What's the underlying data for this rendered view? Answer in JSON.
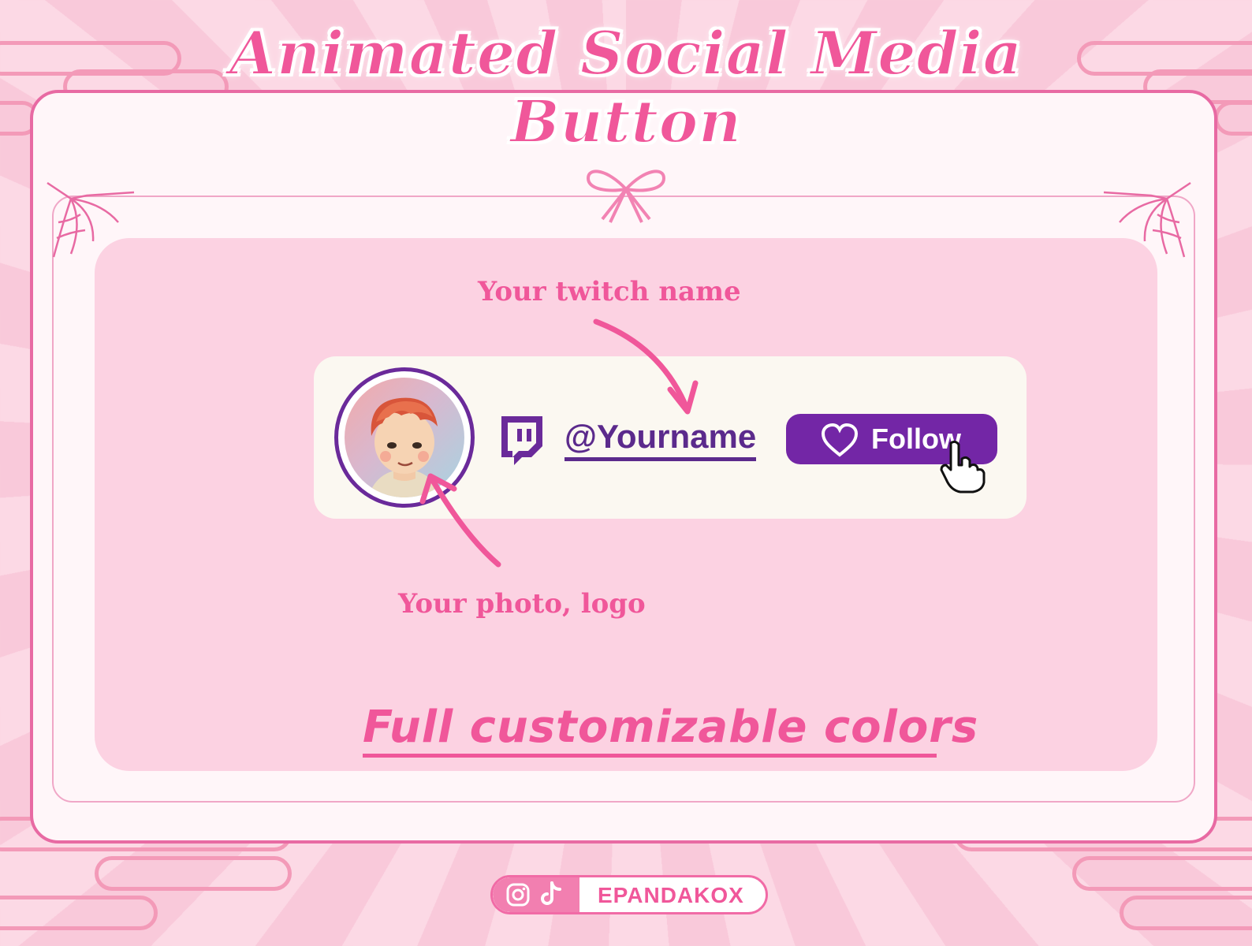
{
  "title": {
    "line1": "Animated Social Media",
    "line2": "Button"
  },
  "annotations": {
    "twitch_name": "Your twitch name",
    "photo": "Your photo, logo"
  },
  "widget": {
    "platform_icon": "twitch-icon",
    "username": "@Yourname",
    "follow_label": "Follow",
    "follow_icon": "heart-icon",
    "cursor_icon": "hand-pointer-icon",
    "accent_color": "#7326a6"
  },
  "tagline": "Full customizable colors",
  "footer": {
    "icons": [
      "instagram-icon",
      "tiktok-icon"
    ],
    "handle": "EPANDAKOX"
  },
  "colors": {
    "pink": "#f0579a",
    "purple": "#6a2a9a",
    "panel": "#fcd2e2"
  }
}
